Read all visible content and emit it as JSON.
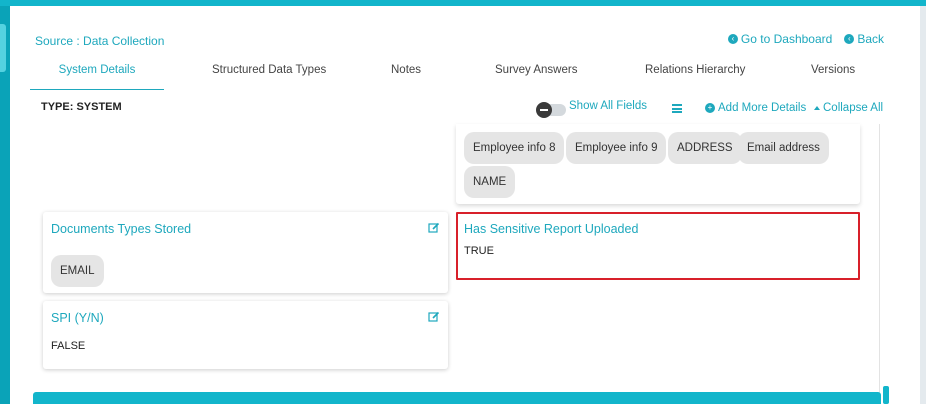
{
  "header": {
    "source": "Source : Data Collection",
    "go_to_dashboard": "Go to Dashboard",
    "back": "Back"
  },
  "tabs": [
    {
      "label": "System Details",
      "active": true
    },
    {
      "label": "Structured Data Types",
      "active": false
    },
    {
      "label": "Notes",
      "active": false
    },
    {
      "label": "Survey Answers",
      "active": false
    },
    {
      "label": "Relations Hierarchy",
      "active": false
    },
    {
      "label": "Versions",
      "active": false
    }
  ],
  "type_label": "TYPE: SYSTEM",
  "toolbar": {
    "show_all_fields": "Show All Fields",
    "show_all_fields_on": false,
    "add_more_details": "Add More Details",
    "collapse_all": "Collapse All"
  },
  "employee_chips": [
    "Employee info 8",
    "Employee info 9",
    "ADDRESS",
    "Email address",
    "NAME"
  ],
  "docs_card": {
    "title": "Documents Types Stored",
    "chips": [
      "EMAIL"
    ]
  },
  "spi_card": {
    "title": "SPI (Y/N)",
    "value": "FALSE"
  },
  "sensitive_card": {
    "title": "Has Sensitive Report Uploaded",
    "value": "TRUE"
  },
  "colors": {
    "accent": "#1ea8bd",
    "brand_bar": "#12b5cb",
    "highlight": "#d8202a",
    "chip_bg": "#e5e5e5"
  },
  "icons": {
    "go_to_dashboard": "arrow-left-circle-icon",
    "back": "arrow-left-circle-icon",
    "menu": "hamburger-menu-icon",
    "add_more": "plus-circle-icon",
    "collapse": "caret-up-icon",
    "edit": "edit-square-icon"
  }
}
